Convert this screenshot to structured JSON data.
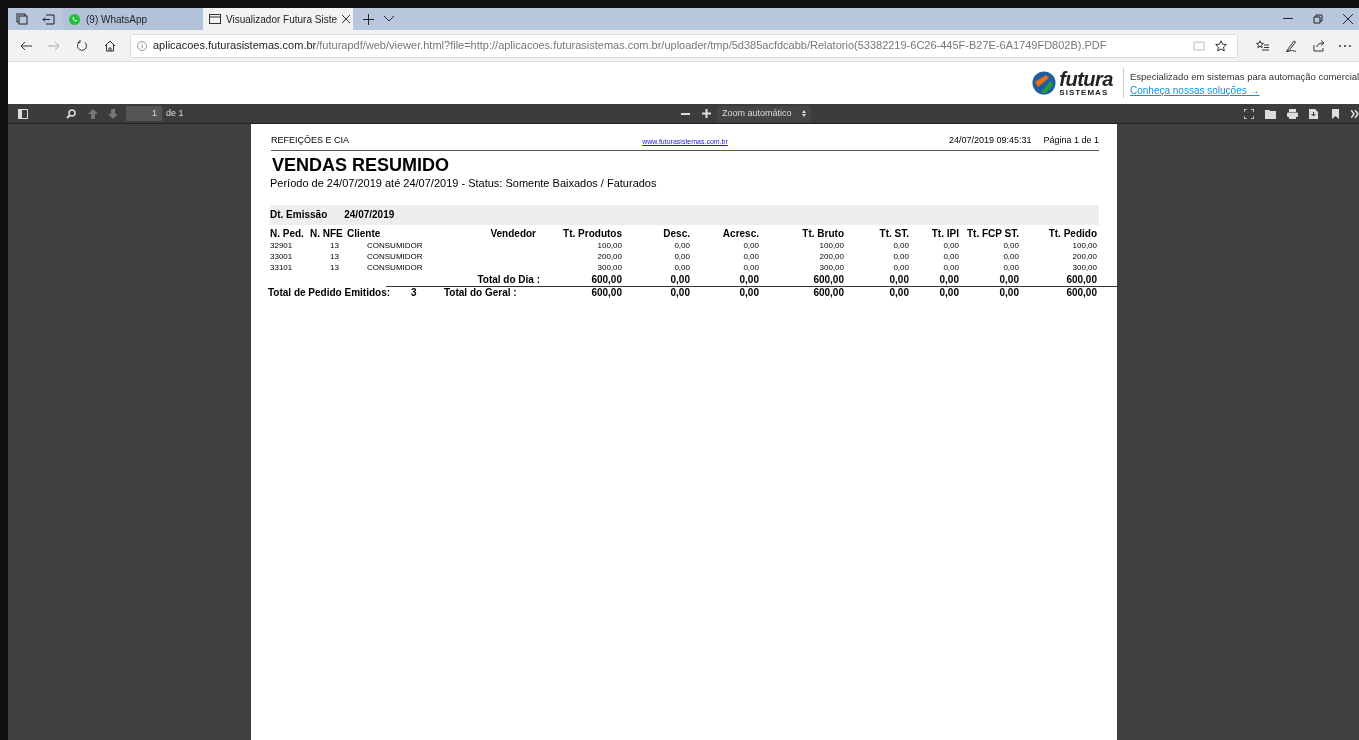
{
  "browser": {
    "tabs": [
      {
        "title": "(9) WhatsApp",
        "kind": "chat",
        "selected": false
      },
      {
        "title": "Visualizador Futura Siste",
        "kind": "page",
        "selected": true
      }
    ],
    "url_host": "aplicacoes.futurasistemas.com.br",
    "url_rest": "/futurapdf/web/viewer.html?file=http://aplicacoes.futurasistemas.com.br/uploader/tmp/5d385acfdcabb/Relatorio(53382219-6C26-445F-B27E-6A1749FD802B).PDF"
  },
  "banner": {
    "logo_name": "futura",
    "logo_sub": "SISTEMAS",
    "tagline": "Especializado em sistemas para automação comercial",
    "link": "Conheça nossas soluções →"
  },
  "pdf_toolbar": {
    "page_number": "1",
    "page_count": "de 1",
    "zoom": "Zoom automático"
  },
  "report": {
    "company": "REFEIÇÕES E CIA",
    "website": "www.futurasistemas.com.br",
    "timestamp": "24/07/2019 09:45:31",
    "page": "Página 1 de 1",
    "title": "VENDAS RESUMIDO",
    "subtitle": "Período de 24/07/2019 até 24/07/2019 - Status: Somente Baixados / Faturados",
    "group_label": "Dt. Emissão",
    "group_value": "24/07/2019",
    "columns": [
      "N. Ped.",
      "N. NFE",
      "Cliente",
      "Vendedor",
      "Tt. Produtos",
      "Desc.",
      "Acresc.",
      "Tt. Bruto",
      "Tt. ST.",
      "Tt. IPI",
      "Tt. FCP ST.",
      "Tt. Pedido"
    ],
    "rows": [
      [
        "32901",
        "13",
        "CONSUMIDOR",
        "",
        "100,00",
        "0,00",
        "0,00",
        "100,00",
        "0,00",
        "0,00",
        "0,00",
        "100,00"
      ],
      [
        "33001",
        "13",
        "CONSUMIDOR",
        "",
        "200,00",
        "0,00",
        "0,00",
        "200,00",
        "0,00",
        "0,00",
        "0,00",
        "200,00"
      ],
      [
        "33101",
        "13",
        "CONSUMIDOR",
        "",
        "300,00",
        "0,00",
        "0,00",
        "300,00",
        "0,00",
        "0,00",
        "0,00",
        "300,00"
      ]
    ],
    "day_total": {
      "label": "Total do Dia :",
      "values": [
        "600,00",
        "0,00",
        "0,00",
        "600,00",
        "0,00",
        "0,00",
        "0,00",
        "600,00"
      ]
    },
    "grand_total": {
      "count_label": "Total de Pedido Emitidos:",
      "count": "3",
      "label": "Total do Geral :",
      "values": [
        "600,00",
        "0,00",
        "0,00",
        "600,00",
        "0,00",
        "0,00",
        "0,00",
        "600,00"
      ]
    }
  }
}
